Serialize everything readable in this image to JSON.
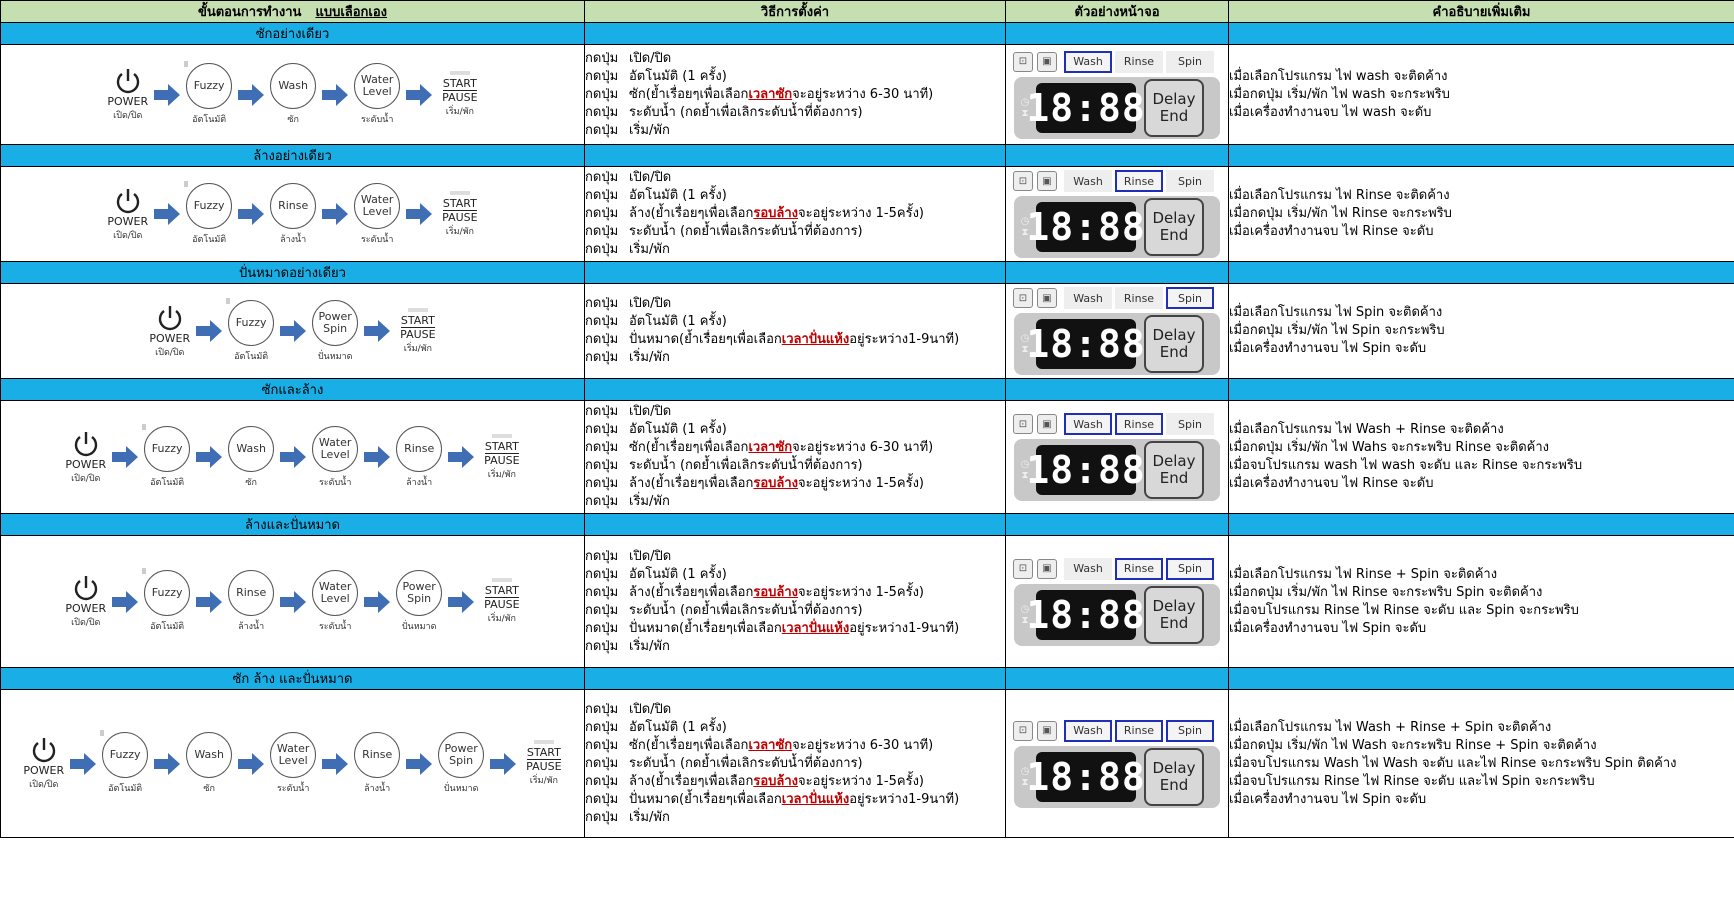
{
  "header": {
    "col1": "ขั้นตอนการทำงาน",
    "col1_mode": "แบบเลือกเอง",
    "col2": "วิธีการตั้งค่า",
    "col3": "ตัวอย่างหน้าจอ",
    "col4": "คำอธิบายเพิ่มเติม"
  },
  "labels": {
    "power": "POWER",
    "power_sub": "เปิด/ปิด",
    "start": "START",
    "pause": "PAUSE",
    "start_sub": "เริ่ม/พัก",
    "press": "กดปุ่ม",
    "wash": "Wash",
    "rinse": "Rinse",
    "spin": "Spin",
    "display": "18:88",
    "delay": "Delay",
    "end": "End"
  },
  "sections": [
    {
      "title": "ซักอย่างเดียว",
      "steps": [
        {
          "label": "Fuzzy",
          "sub": "อัตโนมัติ"
        },
        {
          "label": "Wash",
          "sub": "ซัก"
        },
        {
          "label": "Water Level",
          "sub": "ระดับน้ำ"
        }
      ],
      "instructions": [
        {
          "text": "เปิด/ปิด"
        },
        {
          "text": "อัตโนมัติ   (1 ครั้ง)"
        },
        {
          "text": "ซัก(ย้ำเรื่อยๆเพื่อเลือก",
          "hl": "เวลาซัก",
          "tail": "จะอยู่ระหว่าง    6-30 นาที)"
        },
        {
          "text": "ระดับน้ำ   (กดย้ำเพื่อเลิกระดับน้ำที่ต้องการ)"
        },
        {
          "text": "เริ่ม/พัก"
        }
      ],
      "selected": [
        "Wash"
      ],
      "notes": [
        "เมื่อเลือกโปรแกรม    ไฟ    wash จะติดค้าง",
        "เมื่อกดปุ่ม   เริ่ม/พัก    ไฟ    wash จะกระพริบ",
        "เมื่อเครื่องทำงานจบ    ไฟ    wash จะดับ"
      ]
    },
    {
      "title": "ล้างอย่างเดียว",
      "steps": [
        {
          "label": "Fuzzy",
          "sub": "อัตโนมัติ"
        },
        {
          "label": "Rinse",
          "sub": "ล้างน้ำ"
        },
        {
          "label": "Water Level",
          "sub": "ระดับน้ำ"
        }
      ],
      "instructions": [
        {
          "text": "เปิด/ปิด"
        },
        {
          "text": "อัตโนมัติ   (1 ครั้ง)"
        },
        {
          "text": "ล้าง(ย้ำเรื่อยๆเพื่อเลือก",
          "hl": "รอบล้าง",
          "tail": "จะอยู่ระหว่าง    1-5ครั้ง)"
        },
        {
          "text": "ระดับน้ำ   (กดย้ำเพื่อเลิกระดับน้ำที่ต้องการ)"
        },
        {
          "text": "เริ่ม/พัก"
        }
      ],
      "selected": [
        "Rinse"
      ],
      "notes": [
        "เมื่อเลือกโปรแกรม    ไฟ    Rinse จะติดค้าง",
        "เมื่อกดปุ่ม   เริ่ม/พัก    ไฟ    Rinse จะกระพริบ",
        "เมื่อเครื่องทำงานจบ    ไฟ    Rinse จะดับ"
      ]
    },
    {
      "title": "ปั่นหมาดอย่างเดียว",
      "steps": [
        {
          "label": "Fuzzy",
          "sub": "อัตโนมัติ"
        },
        {
          "label": "Power Spin",
          "sub": "ปั่นหมาด"
        }
      ],
      "instructions": [
        {
          "text": "เปิด/ปิด"
        },
        {
          "text": "อัตโนมัติ   (1 ครั้ง)"
        },
        {
          "text": "ปั่นหมาด(ย้ำเรื่อยๆเพื่อเลือก",
          "hl": "เวลาปั่นแห้ง",
          "tail": "อยู่ระหว่าง1-9นาที)"
        },
        {
          "text": "เริ่ม/พัก"
        }
      ],
      "selected": [
        "Spin"
      ],
      "notes": [
        "เมื่อเลือกโปรแกรม    ไฟ    Spin จะติดค้าง",
        "เมื่อกดปุ่ม   เริ่ม/พัก    ไฟ    Spin จะกระพริบ",
        "เมื่อเครื่องทำงานจบ    ไฟ    Spin จะดับ"
      ]
    },
    {
      "title": "ซักและล้าง",
      "steps": [
        {
          "label": "Fuzzy",
          "sub": "อัตโนมัติ"
        },
        {
          "label": "Wash",
          "sub": "ซัก"
        },
        {
          "label": "Water Level",
          "sub": "ระดับน้ำ"
        },
        {
          "label": "Rinse",
          "sub": "ล้างน้ำ"
        }
      ],
      "instructions": [
        {
          "text": "เปิด/ปิด"
        },
        {
          "text": "อัตโนมัติ   (1 ครั้ง)"
        },
        {
          "text": "ซัก(ย้ำเรื่อยๆเพื่อเลือก",
          "hl": "เวลาซัก",
          "tail": "จะอยู่ระหว่าง    6-30 นาที)"
        },
        {
          "text": "ระดับน้ำ   (กดย้ำเพื่อเลิกระดับน้ำที่ต้องการ)"
        },
        {
          "text": "ล้าง(ย้ำเรื่อยๆเพื่อเลือก",
          "hl": "รอบล้าง",
          "tail": "จะอยู่ระหว่าง    1-5ครั้ง)"
        },
        {
          "text": "เริ่ม/พัก"
        }
      ],
      "selected": [
        "Wash",
        "Rinse"
      ],
      "notes": [
        "เมื่อเลือกโปรแกรม    ไฟ    Wash + Rinse จะติดค้าง",
        "เมื่อกดปุ่ม   เริ่ม/พัก    ไฟ   Wahs จะกระพริบ   Rinse จะติดค้าง",
        "เมื่อจบโปรแกรม   wash ไฟ    wash จะดับ    และ    Rinse จะกระพริบ",
        "เมื่อเครื่องทำงานจบ    ไฟ    Rinse จะดับ"
      ]
    },
    {
      "title": "ล้างและปั่นหมาด",
      "steps": [
        {
          "label": "Fuzzy",
          "sub": "อัตโนมัติ"
        },
        {
          "label": "Rinse",
          "sub": "ล้างน้ำ"
        },
        {
          "label": "Water Level",
          "sub": "ระดับน้ำ"
        },
        {
          "label": "Power Spin",
          "sub": "ปั่นหมาด"
        }
      ],
      "instructions": [
        {
          "text": "เปิด/ปิด"
        },
        {
          "text": "อัตโนมัติ   (1 ครั้ง)"
        },
        {
          "text": "ล้าง(ย้ำเรื่อยๆเพื่อเลือก",
          "hl": "รอบล้าง",
          "tail": "จะอยู่ระหว่าง    1-5ครั้ง)"
        },
        {
          "text": "ระดับน้ำ   (กดย้ำเพื่อเลิกระดับน้ำที่ต้องการ)"
        },
        {
          "text": "ปั่นหมาด(ย้ำเรื่อยๆเพื่อเลือก",
          "hl": "เวลาปั่นแห้ง",
          "tail": "อยู่ระหว่าง1-9นาที)"
        },
        {
          "text": "เริ่ม/พัก"
        }
      ],
      "selected": [
        "Rinse",
        "Spin"
      ],
      "notes": [
        "เมื่อเลือกโปรแกรม    ไฟ    Rinse + Spin จะติดค้าง",
        "เมื่อกดปุ่ม   เริ่ม/พัก    ไฟ    Rinse จะกระพริบ   Spin จะติดค้าง",
        "เมื่อจบโปรแกรม   Rinse ไฟ    Rinse จะดับ    และ    Spin จะกระพริบ",
        "เมื่อเครื่องทำงานจบ    ไฟ    Spin จะดับ"
      ]
    },
    {
      "title": "ซัก    ล้าง    และปั่นหมาด",
      "steps": [
        {
          "label": "Fuzzy",
          "sub": "อัตโนมัติ"
        },
        {
          "label": "Wash",
          "sub": "ซัก"
        },
        {
          "label": "Water Level",
          "sub": "ระดับน้ำ"
        },
        {
          "label": "Rinse",
          "sub": "ล้างน้ำ"
        },
        {
          "label": "Power Spin",
          "sub": "ปั่นหมาด"
        }
      ],
      "instructions": [
        {
          "text": "เปิด/ปิด"
        },
        {
          "text": "อัตโนมัติ   (1 ครั้ง)"
        },
        {
          "text": "ซัก(ย้ำเรื่อยๆเพื่อเลือก",
          "hl": "เวลาซัก",
          "tail": "จะอยู่ระหว่าง    6-30 นาที)"
        },
        {
          "text": "ระดับน้ำ   (กดย้ำเพื่อเลิกระดับน้ำที่ต้องการ)"
        },
        {
          "text": "ล้าง(ย้ำเรื่อยๆเพื่อเลือก",
          "hl": "รอบล้าง",
          "tail": "จะอยู่ระหว่าง    1-5ครั้ง)"
        },
        {
          "text": "ปั่นหมาด(ย้ำเรื่อยๆเพื่อเลือก",
          "hl": "เวลาปั่นแห้ง",
          "tail": "อยู่ระหว่าง1-9นาที)"
        },
        {
          "text": "เริ่ม/พัก"
        }
      ],
      "selected": [
        "Wash",
        "Rinse",
        "Spin"
      ],
      "notes": [
        "เมื่อเลือกโปรแกรม    ไฟ    Wash + Rinse + Spin จะติดค้าง",
        "เมื่อกดปุ่ม   เริ่ม/พัก    ไฟ    Wash จะกระพริบ    Rinse + Spin จะติดค้าง",
        "เมื่อจบโปรแกรม   Wash ไฟ    Wash จะดับ    และไฟ    Rinse  จะกระพริบ    Spin ติดค้าง",
        "เมื่อจบโปรแกรม   Rinse ไฟ    Rinse จะดับ    และไฟ    Spin  จะกระพริบ",
        "เมื่อเครื่องทำงานจบ    ไฟ    Spin จะดับ"
      ]
    }
  ],
  "colors": {
    "header_bg": "#c5dfb0",
    "section_bg": "#1aaee6",
    "highlight": "#c00000",
    "selected_border": "#1f2fb8",
    "arrow": "#3f6eb5"
  }
}
